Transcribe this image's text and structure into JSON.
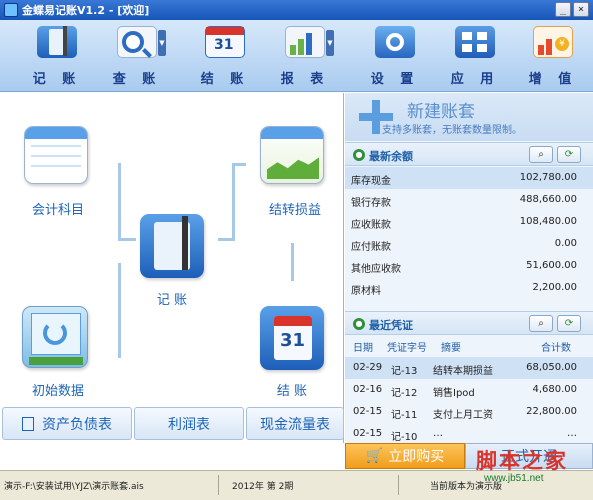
{
  "window": {
    "title": "金蝶易记账V1.2 - [欢迎]",
    "min": "_",
    "close": "×"
  },
  "toolbar": [
    {
      "label": "记 账",
      "icon": "notebook-icon"
    },
    {
      "label": "查 账",
      "icon": "magnifier-ledger-icon"
    },
    {
      "label": "结 账",
      "icon": "calendar-31-icon"
    },
    {
      "label": "报 表",
      "icon": "chart-report-icon"
    },
    {
      "label": "设 置",
      "icon": "gear-settings-icon"
    },
    {
      "label": "应 用",
      "icon": "apps-grid-icon"
    },
    {
      "label": "增 值",
      "icon": "growth-coin-icon"
    }
  ],
  "flow": {
    "accounts": "会计科目",
    "transfer": "结转损益",
    "post": "记 账",
    "opening": "初始数据",
    "close": "结 账"
  },
  "reports": {
    "balance": "资产负债表",
    "income": "利润表",
    "cashflow": "现金流量表"
  },
  "newbook": {
    "title": "新建账套",
    "subtitle": "支持多账套，无账套数量限制。"
  },
  "balance": {
    "title": "最新余额",
    "rows": [
      {
        "name": "库存现金",
        "value": "102,780.00"
      },
      {
        "name": "银行存款",
        "value": "488,660.00"
      },
      {
        "name": "应收账款",
        "value": "108,480.00"
      },
      {
        "name": "应付账款",
        "value": "0.00"
      },
      {
        "name": "其他应收款",
        "value": "51,600.00"
      },
      {
        "name": "原材料",
        "value": "2,200.00"
      }
    ]
  },
  "vouchers": {
    "title": "最近凭证",
    "headers": {
      "date": "日期",
      "no": "凭证字号",
      "desc": "摘要",
      "total": "合计数"
    },
    "rows": [
      {
        "date": "02-29",
        "no": "记-13",
        "desc": "结转本期损益",
        "total": "68,050.00"
      },
      {
        "date": "02-16",
        "no": "记-12",
        "desc": "销售Ipod",
        "total": "4,680.00"
      },
      {
        "date": "02-15",
        "no": "记-11",
        "desc": "支付上月工资",
        "total": "22,800.00"
      },
      {
        "date": "02-15",
        "no": "记-10",
        "desc": "…",
        "total": "…"
      }
    ]
  },
  "actions": {
    "buy": "立即购买",
    "activate": "正式开通"
  },
  "status": {
    "path": "演示-F:\\安装试用\\YJZ\\演示账套.ais",
    "period": "2012年 第 2期",
    "version": "当前版本为演示版"
  },
  "watermark": {
    "text": "脚本之家",
    "url": "www.jb51.net"
  }
}
